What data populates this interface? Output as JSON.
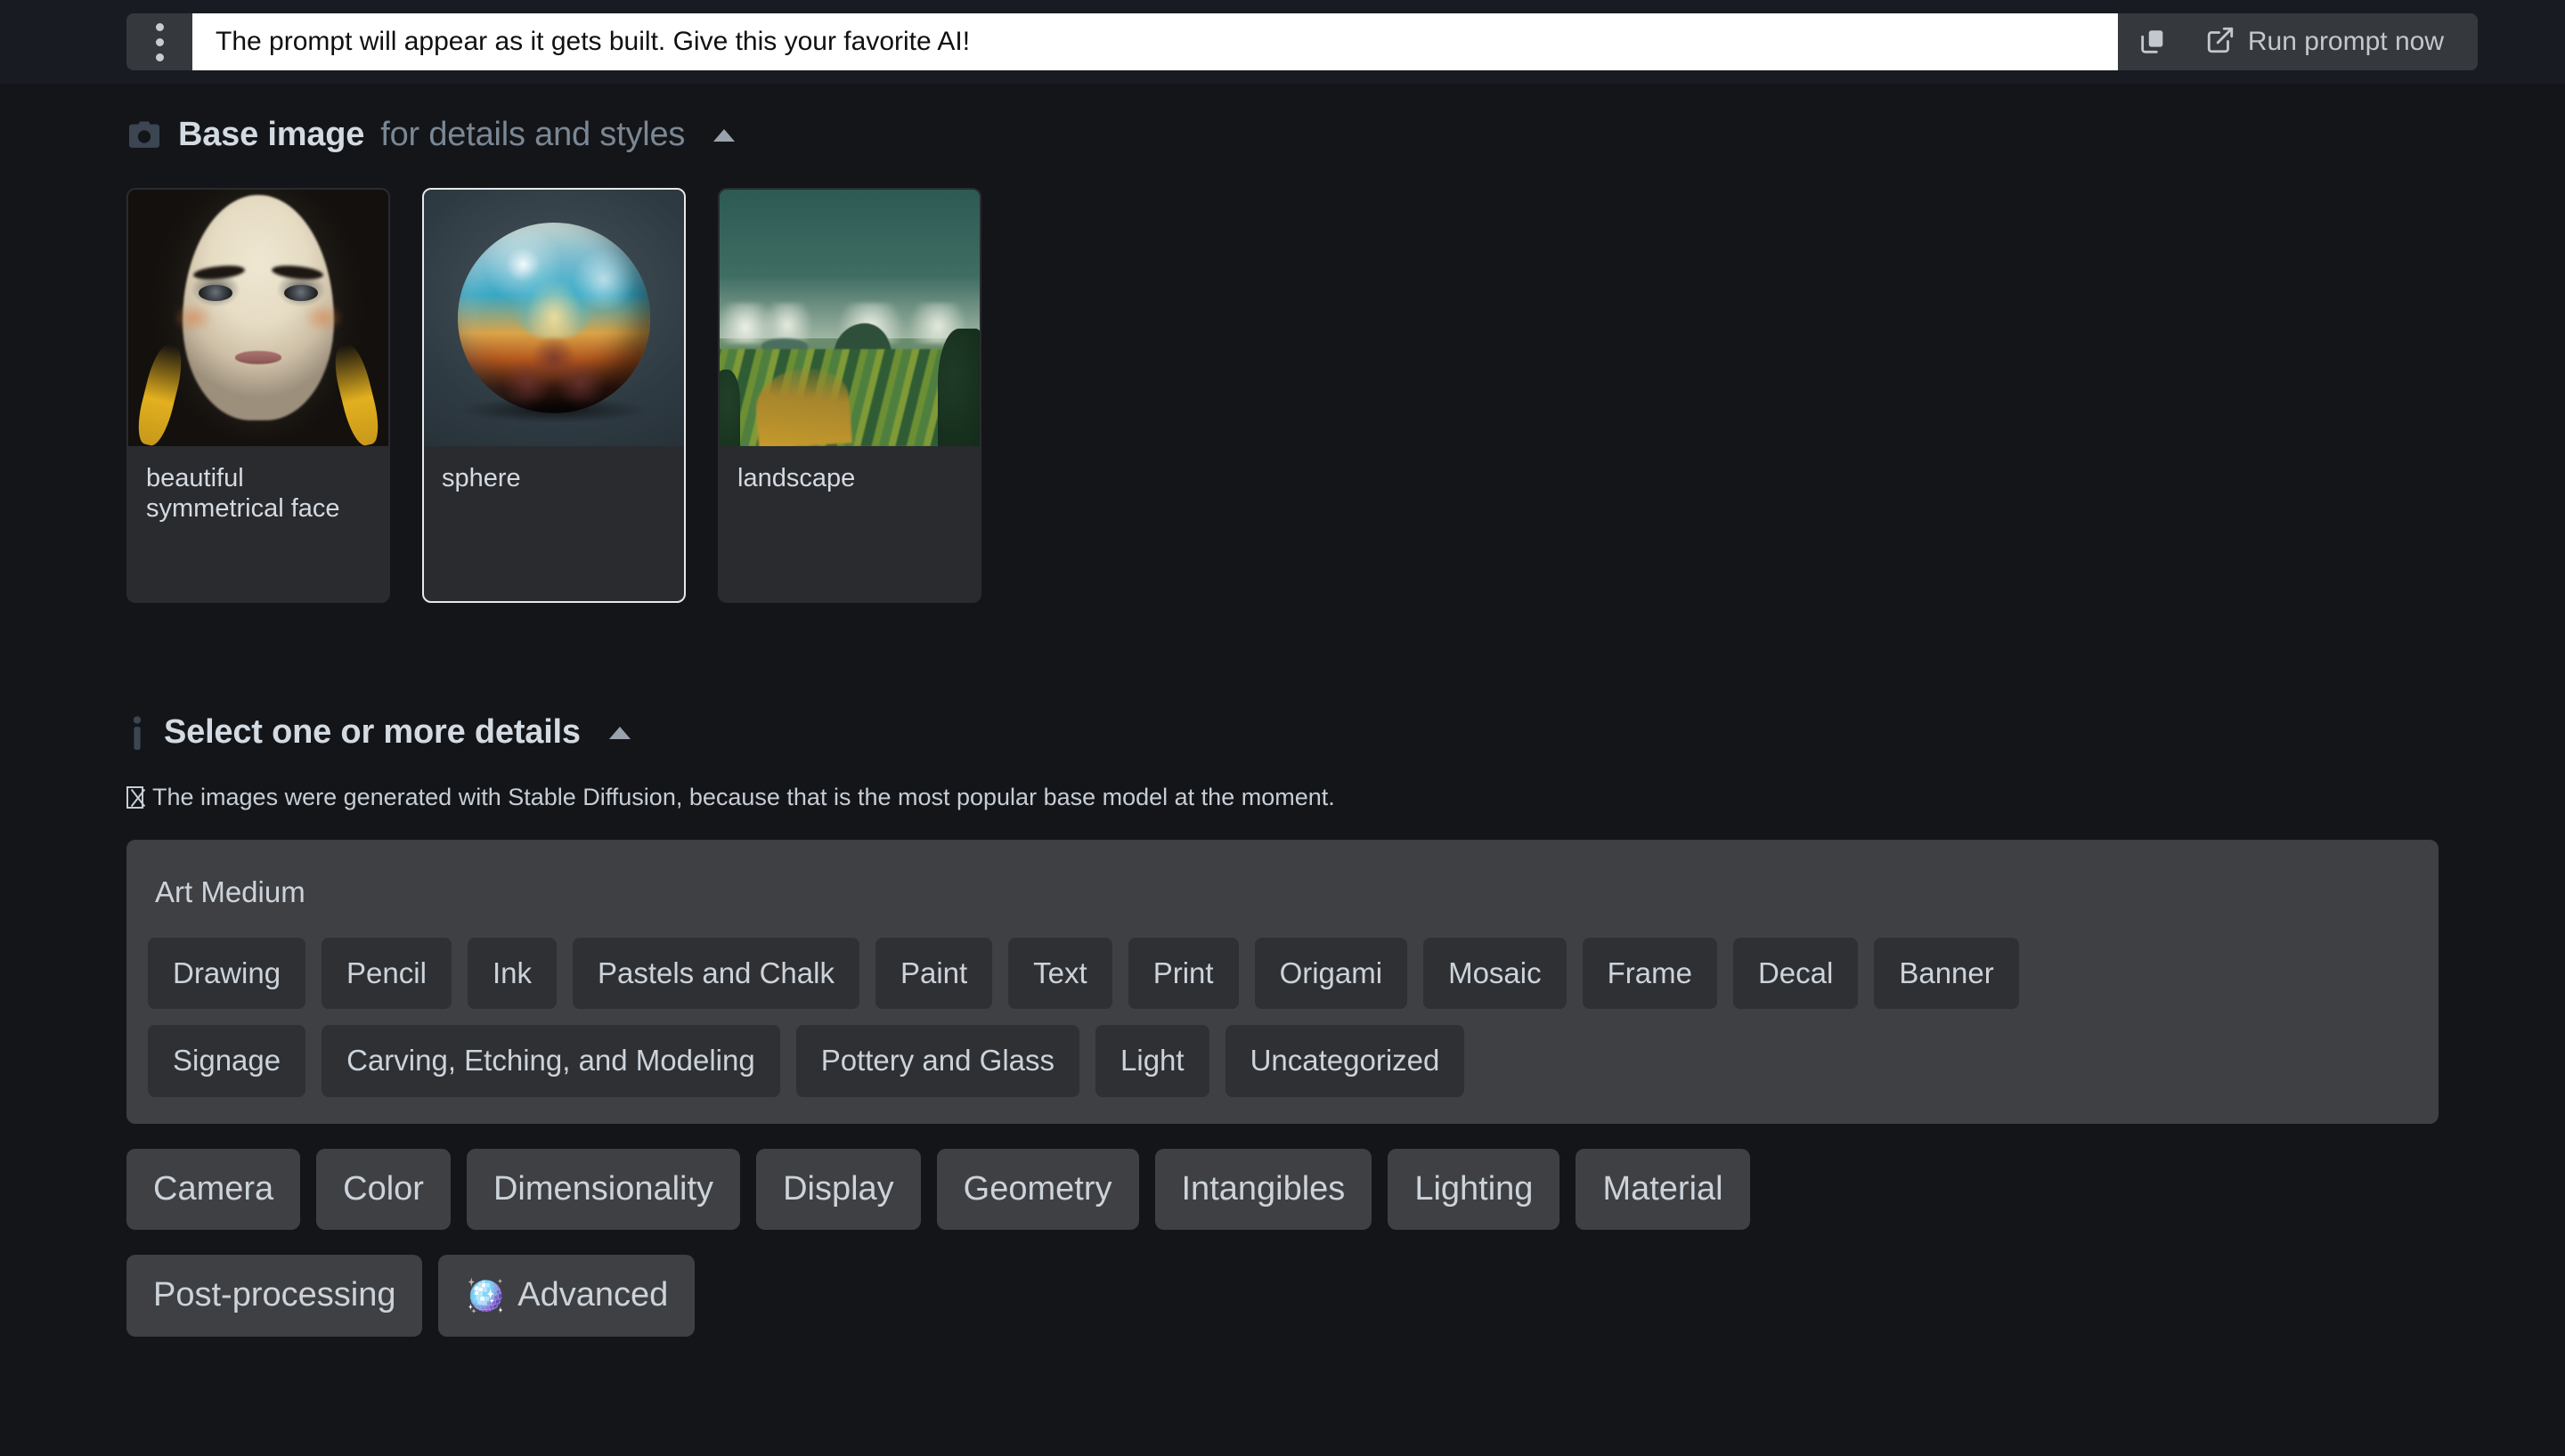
{
  "topbar": {
    "menu_icon": "kebab-menu-icon",
    "prompt_value": "The prompt will appear as it gets built. Give this your favorite AI!",
    "prompt_placeholder": "The prompt will appear as it gets built. Give this your favorite AI!",
    "copy_icon": "copy-icon",
    "run_icon": "external-link-icon",
    "run_label": "Run prompt now"
  },
  "base_image": {
    "icon": "camera-icon",
    "title": "Base image",
    "subtitle": "for details and styles",
    "collapse_icon": "chevron-up-icon",
    "cards": [
      {
        "label": "beautiful symmetrical face",
        "art": "face",
        "selected": false
      },
      {
        "label": "sphere",
        "art": "sphere",
        "selected": true
      },
      {
        "label": "landscape",
        "art": "landscape",
        "selected": false
      }
    ]
  },
  "details": {
    "icon": "info-icon",
    "title": "Select one or more details",
    "collapse_icon": "chevron-up-icon",
    "note_icon": "missing-glyph-box",
    "note": "The images were generated with Stable Diffusion, because that is the most popular base model at the moment.",
    "group": {
      "title": "Art Medium",
      "rows": [
        [
          "Drawing",
          "Pencil",
          "Ink",
          "Pastels and Chalk",
          "Paint",
          "Text",
          "Print",
          "Origami",
          "Mosaic",
          "Frame",
          "Decal",
          "Banner"
        ],
        [
          "Signage",
          "Carving, Etching, and Modeling",
          "Pottery and Glass",
          "Light",
          "Uncategorized"
        ]
      ]
    },
    "categories_row1": [
      {
        "label": "Camera"
      },
      {
        "label": "Color"
      },
      {
        "label": "Dimensionality"
      },
      {
        "label": "Display"
      },
      {
        "label": "Geometry"
      },
      {
        "label": "Intangibles"
      },
      {
        "label": "Lighting"
      },
      {
        "label": "Material"
      }
    ],
    "categories_row2": [
      {
        "label": "Post-processing",
        "glyph": ""
      },
      {
        "label": "Advanced",
        "glyph": "🪩"
      }
    ]
  },
  "colors": {
    "page_bg": "#131519",
    "topbar_bg": "#181b21",
    "panel_bg": "#3f4043",
    "tag_bg": "#2e3034",
    "card_bg": "#292b2f",
    "text": "#ccd3da",
    "muted_text": "#7b8794",
    "selected_border": "#e8e8e8",
    "input_bg": "#ffffff"
  }
}
